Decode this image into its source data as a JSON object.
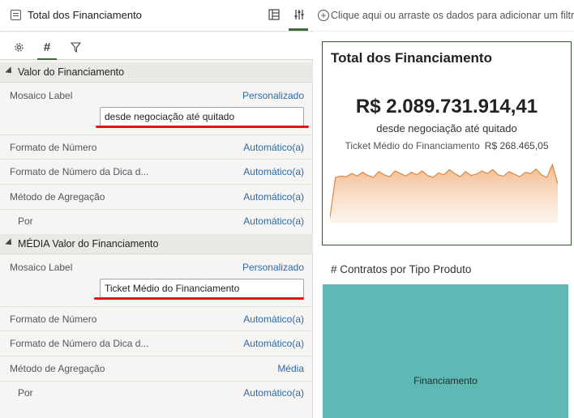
{
  "panel": {
    "title": "Total dos Financiamento",
    "sections": [
      {
        "title": "Valor do Financiamento",
        "mosaic_label_key": "Mosaico Label",
        "mosaic_label_value": "Personalizado",
        "mosaic_label_input": "desde negociação até quitado",
        "rows": [
          {
            "k": "Formato de Número",
            "v": "Automático(a)"
          },
          {
            "k": "Formato de Número da Dica d...",
            "v": "Automático(a)"
          },
          {
            "k": "Método de Agregação",
            "v": "Automático(a)"
          },
          {
            "k": "Por",
            "v": "Automático(a)"
          }
        ]
      },
      {
        "title": "MÉDIA Valor do Financiamento",
        "mosaic_label_key": "Mosaico Label",
        "mosaic_label_value": "Personalizado",
        "mosaic_label_input": "Ticket Médio do Financiamento",
        "rows": [
          {
            "k": "Formato de Número",
            "v": "Automático(a)"
          },
          {
            "k": "Formato de Número da Dica d...",
            "v": "Automático(a)"
          },
          {
            "k": "Método de Agregação",
            "v": "Média"
          },
          {
            "k": "Por",
            "v": "Automático(a)"
          }
        ]
      }
    ]
  },
  "filterbar": {
    "text": "Clique aqui ou arraste os dados para adicionar um filtro"
  },
  "tile": {
    "title": "Total dos Financiamento",
    "value": "R$ 2.089.731.914,41",
    "subtitle": "desde negociação até quitado",
    "avg_label": "Ticket Médio do Financiamento",
    "avg_value": "R$ 268.465,05",
    "sparkline": [
      0.08,
      0.7,
      0.72,
      0.71,
      0.76,
      0.72,
      0.78,
      0.73,
      0.7,
      0.79,
      0.74,
      0.71,
      0.8,
      0.76,
      0.72,
      0.78,
      0.74,
      0.8,
      0.73,
      0.7,
      0.77,
      0.74,
      0.82,
      0.76,
      0.71,
      0.79,
      0.73,
      0.75,
      0.8,
      0.76,
      0.82,
      0.74,
      0.72,
      0.79,
      0.75,
      0.71,
      0.78,
      0.76,
      0.83,
      0.74,
      0.7,
      0.9,
      0.6
    ]
  },
  "chart2": {
    "title": "# Contratos por Tipo Produto",
    "label": "Financiamento",
    "color": "#5fb8b3"
  }
}
